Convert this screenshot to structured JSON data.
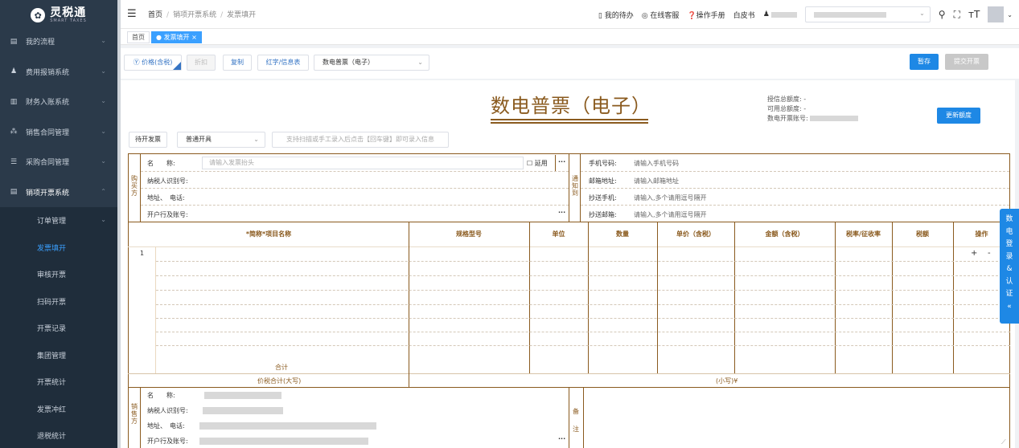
{
  "app": {
    "title": "灵税通",
    "subtitle": "SMART TAXES"
  },
  "sidebar": {
    "items": [
      {
        "label": "我的流程",
        "icon": "doc-icon"
      },
      {
        "label": "费用报销系统",
        "icon": "user-icon"
      },
      {
        "label": "财务入账系统",
        "icon": "grid-icon"
      },
      {
        "label": "销售合同管理",
        "icon": "tree-icon"
      },
      {
        "label": "采购合同管理",
        "icon": "list-icon"
      },
      {
        "label": "销项开票系统",
        "icon": "doc-icon"
      }
    ],
    "subitems": [
      {
        "label": "订单管理"
      },
      {
        "label": "发票填开"
      },
      {
        "label": "审核开票"
      },
      {
        "label": "扫码开票"
      },
      {
        "label": "开票记录"
      },
      {
        "label": "集团管理"
      },
      {
        "label": "开票统计"
      },
      {
        "label": "发票冲红"
      },
      {
        "label": "退税统计"
      }
    ]
  },
  "header": {
    "breadcrumb": [
      "首页",
      "销项开票系统",
      "发票填开"
    ],
    "links": [
      "我的待办",
      "在线客服",
      "操作手册",
      "白皮书"
    ]
  },
  "tags": {
    "home": "首页",
    "active": "发票填开"
  },
  "toolbar": {
    "price_label": "价格(含税)",
    "discount": "折扣",
    "copy": "复制",
    "red_info": "红字/信息表",
    "invoice_type": "数电普票（电子）",
    "save": "暂存",
    "submit": "提交开票"
  },
  "invoice": {
    "title": "数电普票（电子）",
    "quota_total": "授信总额度: -",
    "quota_avail": "可用总额度: -",
    "account": "数电开票账号:",
    "update_quota": "更新额度",
    "pending": "待开发票",
    "issue_type": "普通开具",
    "scan_hint": "支持扫描或手工录入后点击【回车键】即可录入信息",
    "buyer_vertical": "购买方",
    "buyer": {
      "name_label": "名　　称:",
      "name_placeholder": "请输入发票抬头",
      "extend": "延用",
      "tax_id_label": "纳税人识别号:",
      "addr_label": "地址、　电话:",
      "bank_label": "开户行及账号:"
    },
    "notify_vertical": "通知到",
    "notify": {
      "phone_label": "手机号码:",
      "phone_placeholder": "请输入手机号码",
      "email_label": "邮箱地址:",
      "email_placeholder": "请输入邮箱地址",
      "cc_phone_label": "抄送手机:",
      "cc_phone_placeholder": "请输入,多个请用逗号隔开",
      "cc_email_label": "抄送邮箱:",
      "cc_email_placeholder": "请输入,多个请用逗号隔开"
    },
    "table": {
      "headers": [
        "*简称*项目名称",
        "规格型号",
        "单位",
        "数量",
        "单价（含税）",
        "金额（含税）",
        "税率/征收率",
        "税额",
        "操作"
      ],
      "row_index": "1",
      "add": "+",
      "remove": "-",
      "total": "合计",
      "total_words": "价税合计(大写)",
      "total_small": "(小写)¥"
    },
    "seller_vertical": "销售方",
    "seller": {
      "name_label": "名　　称:",
      "tax_id_label": "纳税人识别号:",
      "addr_label": "地址、　电话:",
      "bank_label": "开户行及账号:"
    },
    "remark_vertical": "备注"
  },
  "side_tab": {
    "label": "数电登录&认证",
    "chars": [
      "数",
      "电",
      "登",
      "录",
      "&",
      "认",
      "证"
    ],
    "collapse": "«"
  }
}
